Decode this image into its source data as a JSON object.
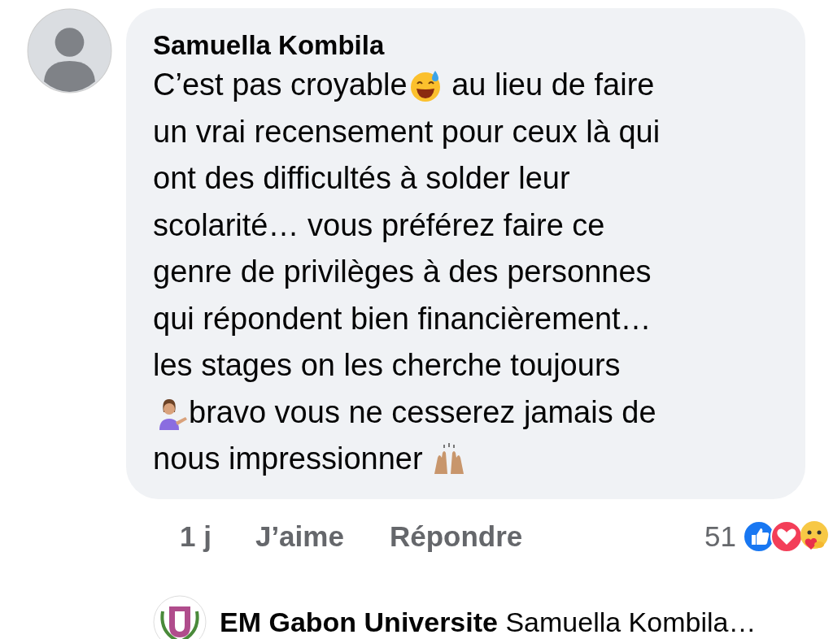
{
  "comment": {
    "author": "Samuella Kombila",
    "lines": [
      [
        {
          "kind": "text",
          "text": "C’est pas croyable"
        },
        {
          "kind": "grin"
        },
        {
          "kind": "text",
          "text": " au lieu de faire"
        }
      ],
      [
        {
          "kind": "text",
          "text": "un vrai recensement pour ceux là qui"
        }
      ],
      [
        {
          "kind": "text",
          "text": "ont des difficultés à solder leur"
        }
      ],
      [
        {
          "kind": "text",
          "text": "scolarité… vous préférez faire ce"
        }
      ],
      [
        {
          "kind": "text",
          "text": "genre de privilèges à des personnes"
        }
      ],
      [
        {
          "kind": "text",
          "text": "qui répondent bien financièrement…"
        }
      ],
      [
        {
          "kind": "text",
          "text": "les stages on les cherche toujours"
        }
      ],
      [
        {
          "kind": "gesture"
        },
        {
          "kind": "text",
          "text": "bravo vous ne cesserez jamais de"
        }
      ],
      [
        {
          "kind": "text",
          "text": "nous impressionner "
        },
        {
          "kind": "hands"
        }
      ]
    ],
    "time": "1 j",
    "like": "J’aime",
    "reply": "Répondre",
    "reaction_count": "51"
  },
  "reply_preview": {
    "author": "EM Gabon Universite",
    "text": "Samuella Kombila…"
  }
}
